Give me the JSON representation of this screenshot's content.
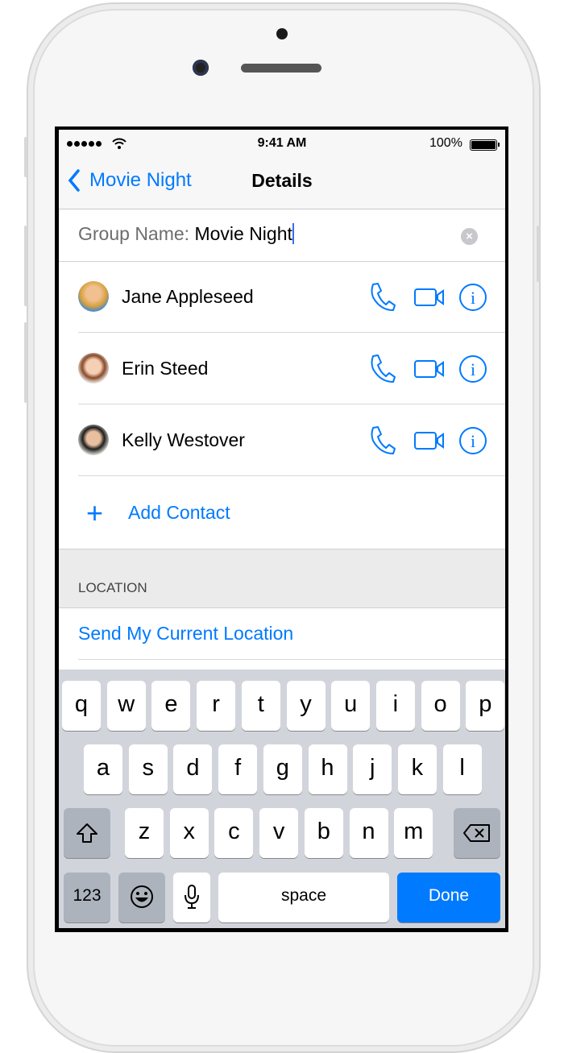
{
  "status_bar": {
    "time": "9:41 AM",
    "battery": "100%"
  },
  "nav": {
    "back_label": "Movie Night",
    "title": "Details"
  },
  "group": {
    "label": "Group Name:",
    "value": "Movie Night"
  },
  "contacts": [
    {
      "name": "Jane Appleseed"
    },
    {
      "name": "Erin Steed"
    },
    {
      "name": "Kelly Westover"
    }
  ],
  "add_contact": {
    "label": "Add Contact"
  },
  "location": {
    "header": "LOCATION",
    "action": "Send My Current Location"
  },
  "keyboard": {
    "row1": [
      "q",
      "w",
      "e",
      "r",
      "t",
      "y",
      "u",
      "i",
      "o",
      "p"
    ],
    "row2": [
      "a",
      "s",
      "d",
      "f",
      "g",
      "h",
      "j",
      "k",
      "l"
    ],
    "row3": [
      "z",
      "x",
      "c",
      "v",
      "b",
      "n",
      "m"
    ],
    "numbers_label": "123",
    "space_label": "space",
    "done_label": "Done"
  },
  "colors": {
    "accent": "#007aff"
  }
}
